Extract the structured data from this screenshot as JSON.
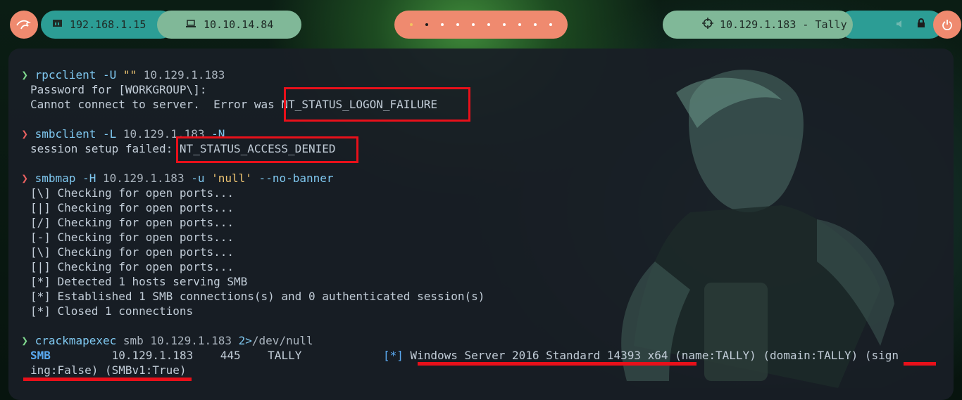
{
  "topbar": {
    "host_ip": "192.168.1.15",
    "vpn_ip": "10.10.14.84",
    "target": "10.129.1.183 - Tally",
    "workspace_count": 10,
    "active_workspace": 2
  },
  "terminal": {
    "blocks": [
      {
        "command": {
          "name": "rpcclient",
          "args": [
            " -U",
            " \"\"",
            " 10.129.1.183"
          ]
        },
        "status": "ok",
        "output": [
          "Password for [WORKGROUP\\]:",
          "Cannot connect to server.  Error was NT_STATUS_LOGON_FAILURE"
        ]
      },
      {
        "command": {
          "name": "smbclient",
          "args": [
            " -L",
            " 10.129.1.183",
            " -N"
          ]
        },
        "status": "error",
        "output": [
          "session setup failed: NT_STATUS_ACCESS_DENIED"
        ]
      },
      {
        "command": {
          "name": "smbmap",
          "args": [
            " -H",
            " 10.129.1.183",
            " -u",
            " 'null'",
            " --no-banner"
          ]
        },
        "status": "error",
        "output": [
          "[\\] Checking for open ports...",
          "[|] Checking for open ports...",
          "[/] Checking for open ports...",
          "[-] Checking for open ports...",
          "[\\] Checking for open ports...",
          "[|] Checking for open ports...",
          "[*] Detected 1 hosts serving SMB",
          "[*] Established 1 SMB connections(s) and 0 authenticated session(s)",
          "[*] Closed 1 connections"
        ]
      },
      {
        "command": {
          "name": "crackmapexec",
          "args": [
            " smb",
            " 10.129.1.183",
            " 2>",
            "/dev/null"
          ]
        },
        "status": "ok",
        "result": {
          "proto": "SMB",
          "host": "10.129.1.183",
          "port": "445",
          "name": "TALLY",
          "marker": "[*]",
          "info": " Windows Server 2016 Standard 14393 x64 (name:TALLY) (domain:TALLY) (sign",
          "wrap": "ing:False) (SMBv1:True)"
        }
      }
    ]
  },
  "prompt_symbol": "❯",
  "colors": {
    "ok": "#7fd88e",
    "error": "#e96060",
    "highlight": "#e8101a"
  }
}
